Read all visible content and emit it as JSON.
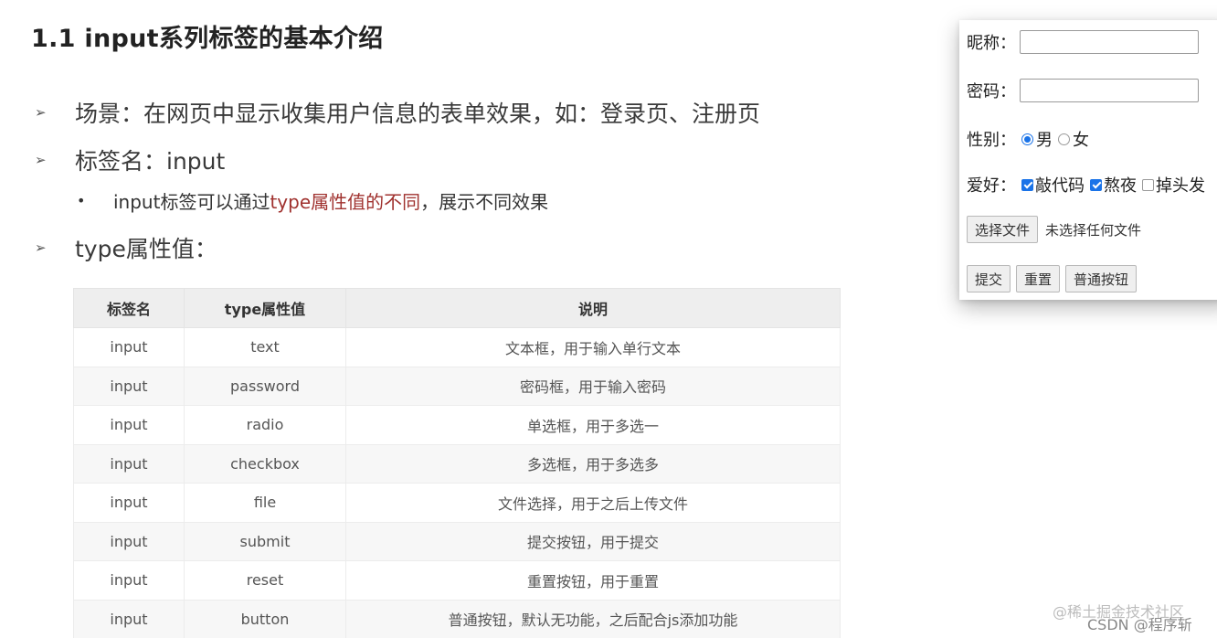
{
  "title": "1.1 input系列标签的基本介绍",
  "bullets": {
    "scene": "场景：在网页中显示收集用户信息的表单效果，如：登录页、注册页",
    "tag_name": "标签名：input",
    "sub_prefix": "input标签可以通过",
    "sub_highlight": "type属性值的不同",
    "sub_suffix": "，展示不同效果",
    "type_values": "type属性值："
  },
  "table": {
    "headers": [
      "标签名",
      "type属性值",
      "说明"
    ],
    "rows": [
      [
        "input",
        "text",
        "文本框，用于输入单行文本"
      ],
      [
        "input",
        "password",
        "密码框，用于输入密码"
      ],
      [
        "input",
        "radio",
        "单选框，用于多选一"
      ],
      [
        "input",
        "checkbox",
        "多选框，用于多选多"
      ],
      [
        "input",
        "file",
        "文件选择，用于之后上传文件"
      ],
      [
        "input",
        "submit",
        "提交按钮，用于提交"
      ],
      [
        "input",
        "reset",
        "重置按钮，用于重置"
      ],
      [
        "input",
        "button",
        "普通按钮，默认无功能，之后配合js添加功能"
      ]
    ]
  },
  "demo": {
    "nickname_label": "昵称：",
    "password_label": "密码：",
    "gender_label": "性别：",
    "gender_male": "男",
    "gender_female": "女",
    "gender_selected": "男",
    "hobby_label": "爱好：",
    "hobby_1": "敲代码",
    "hobby_2": "熬夜",
    "hobby_3": "掉头发",
    "hobbies_checked": [
      "敲代码",
      "熬夜"
    ],
    "file_button": "选择文件",
    "file_status": "未选择任何文件",
    "submit_button": "提交",
    "reset_button": "重置",
    "normal_button": "普通按钮",
    "accent_color": "#1a73e8"
  },
  "watermark": {
    "line1": "@稀土掘金技术社区",
    "line2": "CSDN @程序斩"
  }
}
